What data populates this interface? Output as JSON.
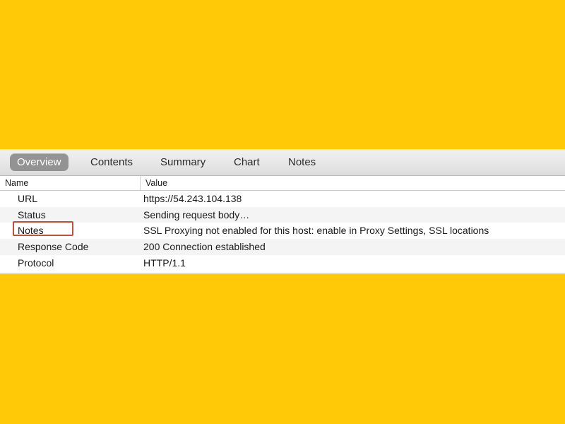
{
  "background": {
    "color": "#FFC907"
  },
  "panel": {
    "accent_selected_tab": "#939393",
    "annotation_color": "#c25038",
    "tabs": [
      {
        "label": "Overview",
        "selected": true
      },
      {
        "label": "Contents",
        "selected": false
      },
      {
        "label": "Summary",
        "selected": false
      },
      {
        "label": "Chart",
        "selected": false
      },
      {
        "label": "Notes",
        "selected": false
      }
    ],
    "table": {
      "columns": [
        "Name",
        "Value"
      ],
      "rows": [
        {
          "name": "URL",
          "value": "https://54.243.104.138"
        },
        {
          "name": "Status",
          "value": "Sending request body…"
        },
        {
          "name": "Notes",
          "value": "SSL Proxying not enabled for this host: enable in Proxy Settings, SSL locations"
        },
        {
          "name": "Response Code",
          "value": "200 Connection established"
        },
        {
          "name": "Protocol",
          "value": "HTTP/1.1"
        }
      ]
    },
    "annotation": {
      "target_label": "Notes"
    }
  }
}
